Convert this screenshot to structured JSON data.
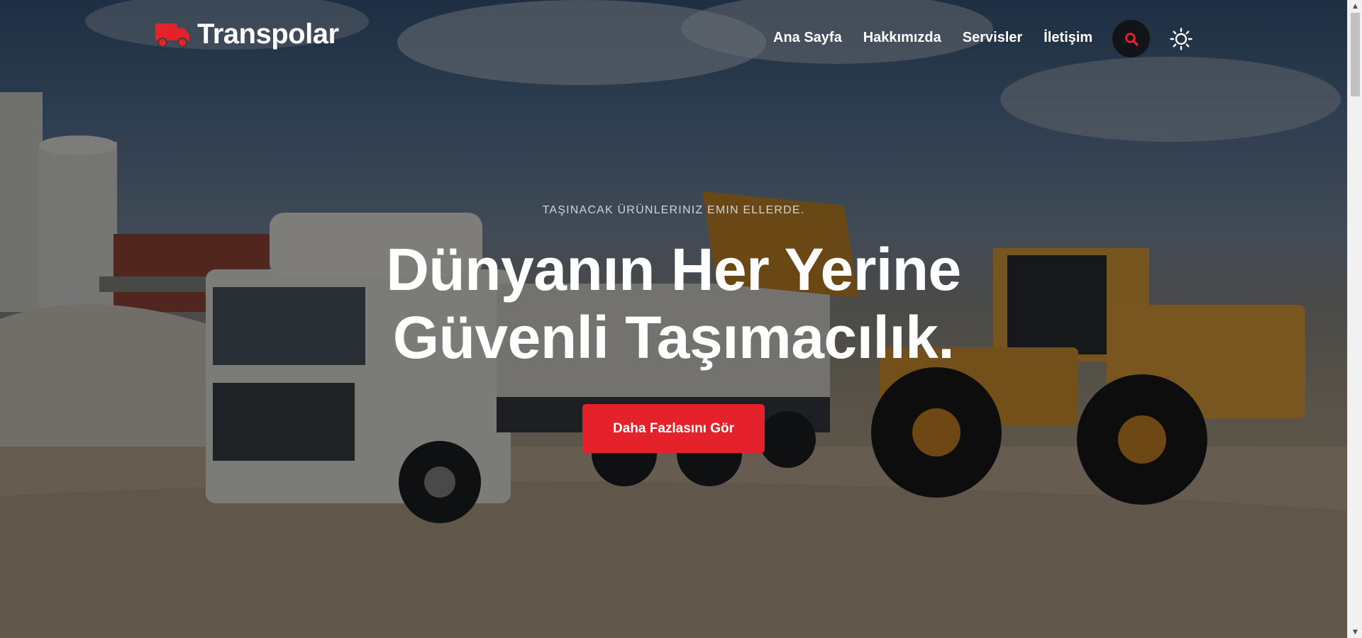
{
  "brand": {
    "name": "Transpolar",
    "logo_icon": "truck-icon",
    "accent_color": "#e5212b"
  },
  "nav": {
    "items": [
      {
        "label": "Ana Sayfa"
      },
      {
        "label": "Hakkımızda"
      },
      {
        "label": "Servisler"
      },
      {
        "label": "İletişim"
      }
    ]
  },
  "header_actions": {
    "search_icon": "search-icon",
    "theme_icon": "sun-icon"
  },
  "hero": {
    "eyebrow": "TAŞINACAK ÜRÜNLERINIZ EMIN ELLERDE.",
    "title_line_1": "Dünyanın Her Yerine",
    "title_line_2": "Güvenli Taşımacılık.",
    "cta_label": "Daha Fazlasını Gör",
    "background_subject": "truck-and-wheel-loader-photo"
  },
  "scrollbar": {
    "up_icon": "scroll-up-arrow-icon",
    "down_icon": "scroll-down-arrow-icon"
  }
}
